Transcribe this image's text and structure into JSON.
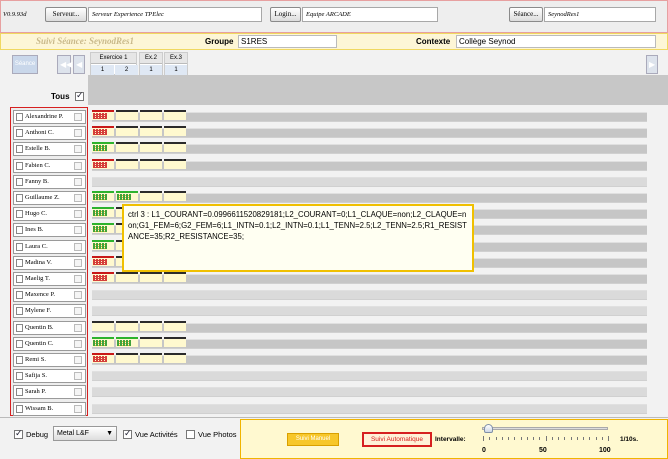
{
  "topbar": {
    "version": "V0.9.93d",
    "server_button": "Serveur...",
    "server_value": "Serveur Experience TPElec",
    "login_button": "Login...",
    "login_value": "Equipe ARCADE",
    "seance_button": "Séance...",
    "seance_value": "SeynodRes1"
  },
  "session": {
    "suivi_label": "Suivi Séance: SeynodRes1",
    "groupe_label": "Groupe",
    "groupe_value": "S1RES",
    "contexte_label": "Contexte",
    "contexte_value": "Collège Seynod"
  },
  "nav": {
    "seance_button": "Séance"
  },
  "exercises": [
    {
      "name": "Exercice 1",
      "numbers": [
        "1",
        "2"
      ]
    },
    {
      "name": "Ex.2",
      "numbers": [
        "1"
      ]
    },
    {
      "name": "Ex.3",
      "numbers": [
        "1"
      ]
    }
  ],
  "tous_label": "Tous",
  "students": [
    {
      "name": "Alexandrine P.",
      "row": "data"
    },
    {
      "name": "Anthoni C.",
      "row": "data"
    },
    {
      "name": "Estelle B.",
      "row": "data"
    },
    {
      "name": "Fabien C.",
      "row": "data"
    },
    {
      "name": "Fanny B.",
      "row": "empty"
    },
    {
      "name": "Guillaume Z.",
      "row": "data"
    },
    {
      "name": "Hugo C.",
      "row": "data"
    },
    {
      "name": "Ines B.",
      "row": "data"
    },
    {
      "name": "Laura C.",
      "row": "data"
    },
    {
      "name": "Madina V.",
      "row": "data"
    },
    {
      "name": "Maelig T.",
      "row": "data"
    },
    {
      "name": "Maxence P.",
      "row": "empty"
    },
    {
      "name": "Mylene F.",
      "row": "empty"
    },
    {
      "name": "Quentin B.",
      "row": "data"
    },
    {
      "name": "Quentin C.",
      "row": "data"
    },
    {
      "name": "Remi S.",
      "row": "data"
    },
    {
      "name": "Safija S.",
      "row": "empty"
    },
    {
      "name": "Sarah P.",
      "row": "empty"
    },
    {
      "name": "Wissam B.",
      "row": "empty"
    }
  ],
  "tooltip": "ctrl 3 : L1_COURANT=0.0996611520829181;L2_COURANT=0;L1_CLAQUE=non;L2_CLAQUE=non;G1_FEM=6;G2_FEM=6;L1_INTN=0.1;L2_INTN=0.1;L1_TENN=2.5;L2_TENN=2.5;R1_RESISTANCE=35;R2_RESISTANCE=35;",
  "bottom": {
    "debug_label": "Debug",
    "laf_value": "Metal L&F",
    "vue_activites_label": "Vue Activités",
    "vue_photos_label": "Vue Photos",
    "suivi_manuel": "Suivi Manuel",
    "suivi_automatique": "Suivi Automatique",
    "intervalle_label": "Intervalle:",
    "unit_label": "1/10s.",
    "slider_ticks": [
      "0",
      "50",
      "100"
    ],
    "slider_value": 5
  },
  "colors": {
    "accent_red": "#d62020",
    "accent_yellow": "#f0c000",
    "ok_green": "#2db22d"
  }
}
